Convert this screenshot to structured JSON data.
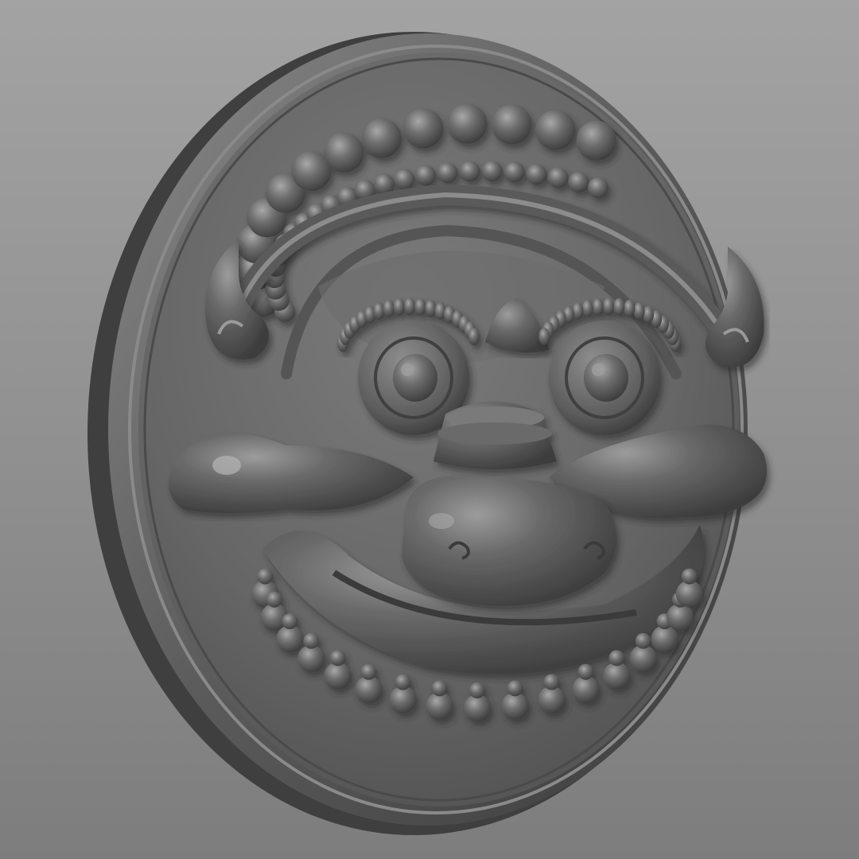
{
  "scene": {
    "subject": "carved-relief-medallion",
    "colors": {
      "background_top": "#a3a3a3",
      "background_bottom": "#7d7d7d",
      "relief_base": "#6a6a6a",
      "relief_highlight": "#9a9a9a",
      "relief_shadow": "#3a3a3a"
    },
    "crown_beads": 13,
    "inner_beads": 24,
    "necklace_beads": 17
  }
}
